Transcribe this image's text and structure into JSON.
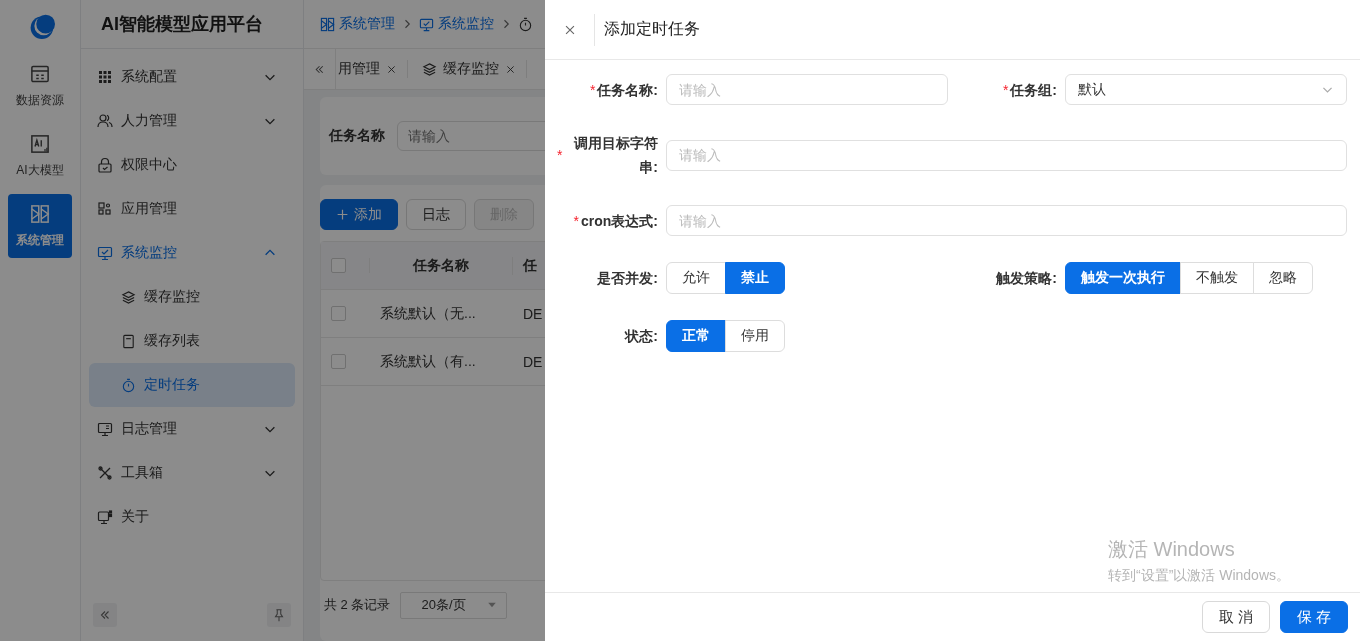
{
  "rail": {
    "items": [
      {
        "label": "数据资源",
        "selected": false
      },
      {
        "label": "AI大模型",
        "selected": false
      },
      {
        "label": "系统管理",
        "selected": true
      }
    ]
  },
  "app_title": "AI智能模型应用平台",
  "menu": {
    "items": [
      {
        "label": "系统配置",
        "expanded": false
      },
      {
        "label": "人力管理",
        "expanded": false
      },
      {
        "label": "权限中心"
      },
      {
        "label": "应用管理"
      },
      {
        "label": "系统监控",
        "expanded": true,
        "children": [
          {
            "label": "缓存监控",
            "selected": false
          },
          {
            "label": "缓存列表",
            "selected": false
          },
          {
            "label": "定时任务",
            "selected": true
          }
        ]
      },
      {
        "label": "日志管理",
        "expanded": false
      },
      {
        "label": "工具箱",
        "expanded": false
      },
      {
        "label": "关于"
      }
    ]
  },
  "breadcrumb": [
    "系统管理",
    "系统监控"
  ],
  "tabs": [
    {
      "label": "用管理",
      "selected": false
    },
    {
      "label": "缓存监控",
      "selected": false
    }
  ],
  "search": {
    "label": "任务名称",
    "placeholder": "请输入"
  },
  "toolbar": [
    {
      "label": "添加",
      "kind": "primary"
    },
    {
      "label": "日志",
      "kind": "default"
    },
    {
      "label": "删除",
      "kind": "default",
      "disabled": true
    }
  ],
  "table": {
    "all_checked": false,
    "columns": [
      "任务名称",
      "任"
    ],
    "rows": [
      {
        "checked": false,
        "cells": [
          "系统默认（无...",
          "DE"
        ]
      },
      {
        "checked": false,
        "cells": [
          "系统默认（有...",
          "DE"
        ]
      }
    ]
  },
  "pagination": {
    "total": "共 2 条记录",
    "page_size": "20条/页"
  },
  "drawer": {
    "title": "添加定时任务",
    "rows": [
      [
        {
          "kind": "input",
          "required_mark": "*",
          "label": "任务名称:",
          "placeholder": "请输入"
        },
        {
          "kind": "select",
          "required_mark": "*",
          "label": "任务组:",
          "value": "默认"
        }
      ],
      [
        {
          "kind": "input",
          "required_mark": "*",
          "label": "调用目标字符串:",
          "placeholder": "请输入"
        }
      ],
      [
        {
          "kind": "input",
          "required_mark": "*",
          "label": "cron表达式:",
          "placeholder": "请输入"
        }
      ],
      [
        {
          "kind": "radio",
          "label": "是否并发:",
          "options": [
            {
              "label": "允许",
              "selected": false
            },
            {
              "label": "禁止",
              "selected": true
            }
          ]
        },
        {
          "kind": "radio",
          "label": "触发策略:",
          "options": [
            {
              "label": "触发一次执行",
              "selected": true
            },
            {
              "label": "不触发",
              "selected": false
            },
            {
              "label": "忽略",
              "selected": false
            }
          ]
        }
      ],
      [
        {
          "kind": "radio",
          "label": "状态:",
          "options": [
            {
              "label": "正常",
              "selected": true
            },
            {
              "label": "停用",
              "selected": false
            }
          ]
        }
      ]
    ],
    "buttons": [
      {
        "label": "取 消",
        "kind": "default"
      },
      {
        "label": "保 存",
        "kind": "primary"
      }
    ]
  },
  "os_notice": {
    "title": "激活 Windows",
    "text": "转到“设置”以激活 Windows。"
  }
}
